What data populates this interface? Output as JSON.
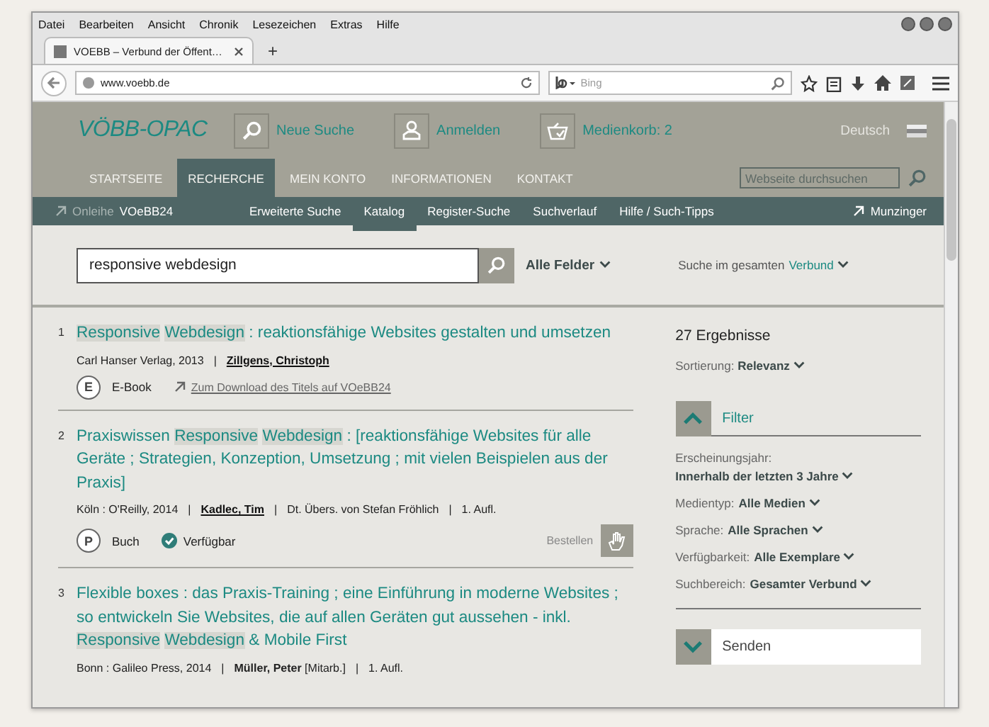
{
  "menu_bar": [
    "Datei",
    "Bearbeiten",
    "Ansicht",
    "Chronik",
    "Lesezeichen",
    "Extras",
    "Hilfe"
  ],
  "tabs": [
    {
      "label": "VOEBB – Verbund der Öffent…",
      "selected": true
    }
  ],
  "new_tab": "+",
  "address_bar": {
    "value": "www.voebb.de"
  },
  "browser_search": {
    "placeholder": "Bing"
  },
  "header": {
    "logo": "VÖBB-OPAC",
    "actions": [
      {
        "kind": "search",
        "label": "Neue Suche"
      },
      {
        "kind": "user",
        "label": "Anmelden"
      },
      {
        "kind": "basket",
        "label": "Medienkorb: 2"
      }
    ],
    "language": "Deutsch"
  },
  "main_nav": [
    {
      "label": "STARTSEITE",
      "selected": false
    },
    {
      "label": "RECHERCHE",
      "selected": true
    },
    {
      "label": "MEIN KONTO",
      "selected": false
    },
    {
      "label": "INFORMATIONEN",
      "selected": false
    },
    {
      "label": "KONTAKT",
      "selected": false
    }
  ],
  "site_search": {
    "placeholder": "Webseite durchsuchen"
  },
  "sub_nav": {
    "left_link": {
      "prefix": "Onleihe",
      "label": "VOeBB24"
    },
    "items": [
      {
        "label": "Erweiterte Suche",
        "selected": false
      },
      {
        "label": "Katalog",
        "selected": true
      },
      {
        "label": "Register-Suche",
        "selected": false
      },
      {
        "label": "Suchverlauf",
        "selected": false
      },
      {
        "label": "Hilfe / Such-Tipps",
        "selected": false
      }
    ],
    "right_link": "Munzinger"
  },
  "search": {
    "value": "responsive webdesign",
    "field": "Alle Felder",
    "scope_prefix": "Suche im gesamten",
    "scope": "Verbund"
  },
  "results": [
    {
      "number": "1",
      "title": [
        {
          "text": "Responsive",
          "highlighted": true
        },
        {
          "text": "Webdesign",
          "highlighted": true
        },
        {
          "text": " : reaktionsfähige Websites gestalten und umsetzen",
          "highlighted": false
        }
      ],
      "meta": [
        {
          "kind": "text",
          "text": "Carl Hanser Verlag, 2013"
        },
        {
          "kind": "separator",
          "text": "|"
        },
        {
          "kind": "author",
          "text": "Zillgens, Christoph"
        }
      ],
      "format": {
        "letter": "E",
        "label": "E-Book"
      },
      "download_link": "Zum Download des Titels auf VOeBB24"
    },
    {
      "number": "2",
      "title": [
        {
          "text": "Praxiswissen ",
          "highlighted": false
        },
        {
          "text": "Responsive",
          "highlighted": true
        },
        {
          "text": "Webdesign",
          "highlighted": true
        },
        {
          "text": " : [reaktionsfähige Websites für alle Geräte ; Strategien, Konzeption, Umsetzung ; mit vielen Beispielen aus der Praxis]",
          "highlighted": false
        }
      ],
      "meta": [
        {
          "kind": "text",
          "text": "Köln : O'Reilly, 2014"
        },
        {
          "kind": "separator",
          "text": "|"
        },
        {
          "kind": "author",
          "text": "Kadlec, Tim"
        },
        {
          "kind": "separator",
          "text": "|"
        },
        {
          "kind": "text",
          "text": "Dt. Übers. von Stefan Fröhlich"
        },
        {
          "kind": "separator",
          "text": "|"
        },
        {
          "kind": "text",
          "text": "1. Aufl."
        }
      ],
      "format": {
        "letter": "P",
        "label": "Buch"
      },
      "availability": "Verfügbar",
      "order": "Bestellen"
    },
    {
      "number": "3",
      "title": [
        {
          "text": "Flexible boxes : das Praxis-Training ; eine Einführung in moderne Websites ; so entwickeln Sie Websites, die auf allen Geräten gut aussehen - inkl. ",
          "highlighted": false
        },
        {
          "text": "Responsive",
          "highlighted": true
        },
        {
          "text": "Webdesign",
          "highlighted": true
        },
        {
          "text": " & Mobile First",
          "highlighted": false
        }
      ],
      "meta": [
        {
          "kind": "text",
          "text": "Bonn : Galileo Press, 2014"
        },
        {
          "kind": "separator",
          "text": "|"
        },
        {
          "kind": "text",
          "text": "**Müller, Peter** [Mitarb.]"
        },
        {
          "kind": "separator",
          "text": "|"
        },
        {
          "kind": "text",
          "text": "1. Aufl."
        }
      ]
    }
  ],
  "sidebar": {
    "count": "27 Ergebnisse",
    "sort_label": "Sortierung:",
    "sort_value": "Relevanz",
    "sections": [
      {
        "label": "Filter",
        "expanded": true,
        "filters": [
          {
            "label": "Erscheinungsjahr:",
            "value": "Innerhalb der letzten 3 Jahre",
            "stacked": true
          },
          {
            "label": "Medientyp:",
            "value": "Alle Medien",
            "stacked": false
          },
          {
            "label": "Sprache:",
            "value": "Alle Sprachen",
            "stacked": false
          },
          {
            "label": "Verfügbarkeit:",
            "value": "Alle Exemplare",
            "stacked": false
          },
          {
            "label": "Suchbereich:",
            "value": "Gesamter Verbund",
            "stacked": false
          }
        ]
      },
      {
        "label": "Senden",
        "expanded": false
      }
    ]
  }
}
